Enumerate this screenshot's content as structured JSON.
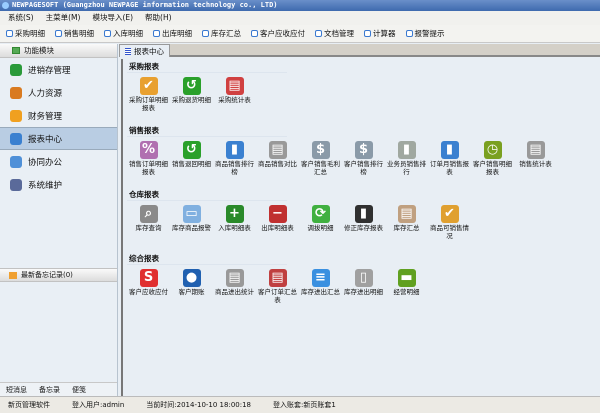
{
  "title": "NEWPAGESOFT (Guangzhou NEWPAGE information technology co., LTD)",
  "menu": [
    "系统(S)",
    "主菜单(M)",
    "模块导入(E)",
    "帮助(H)"
  ],
  "toolbar": [
    "采购明细",
    "销售明细",
    "入库明细",
    "出库明细",
    "库存汇总",
    "客户应收应付",
    "文档管理",
    "计算器",
    "报警提示"
  ],
  "left": {
    "header": "功能模块",
    "nav": [
      {
        "label": "进销存管理",
        "color": "#2a9a3a"
      },
      {
        "label": "人力资源",
        "color": "#d97a20"
      },
      {
        "label": "财务管理",
        "color": "#f0a020"
      },
      {
        "label": "报表中心",
        "color": "#3a80d0"
      },
      {
        "label": "协同办公",
        "color": "#4f90d8"
      },
      {
        "label": "系统维护",
        "color": "#5a6a9a"
      }
    ],
    "selected": "报表中心",
    "memo": "最新备忘记录(0)",
    "bottom_tabs": [
      "短消息",
      "备忘录",
      "便笺"
    ]
  },
  "tab": "报表中心",
  "sections": [
    {
      "title": "采购报表",
      "items": [
        {
          "label": "采购订单明细报表",
          "color": "#e8a030",
          "glyph": "✔"
        },
        {
          "label": "采购退货明细",
          "color": "#2aa02a",
          "glyph": "↺"
        },
        {
          "label": "采购统计表",
          "color": "#d04040",
          "glyph": "▤"
        }
      ]
    },
    {
      "title": "销售报表",
      "items": [
        {
          "label": "销售订单明细报表",
          "color": "#b070b0",
          "glyph": "%"
        },
        {
          "label": "销售退回明细",
          "color": "#2aa02a",
          "glyph": "↺"
        },
        {
          "label": "商品销售排行榜",
          "color": "#3a80d0",
          "glyph": "▮"
        },
        {
          "label": "商品销售对比",
          "color": "#999999",
          "glyph": "▤"
        },
        {
          "label": "客户销售毛利汇总",
          "color": "#8a9aa8",
          "glyph": "$"
        },
        {
          "label": "客户销售排行榜",
          "color": "#8a9aa8",
          "glyph": "$"
        },
        {
          "label": "业务员销售排行",
          "color": "#a0a8a0",
          "glyph": "▮"
        },
        {
          "label": "订单月销售报表",
          "color": "#3a80d0",
          "glyph": "▮"
        },
        {
          "label": "客户销售明细报表",
          "color": "#7aa020",
          "glyph": "◷"
        },
        {
          "label": "销售统计表",
          "color": "#999999",
          "glyph": "▤"
        }
      ]
    },
    {
      "title": "仓库报表",
      "items": [
        {
          "label": "库存查询",
          "color": "#8a8a8a",
          "glyph": "⌕"
        },
        {
          "label": "库存商品报警",
          "color": "#80b0e0",
          "glyph": "▭"
        },
        {
          "label": "入库明细表",
          "color": "#2a8a2a",
          "glyph": "+"
        },
        {
          "label": "出库明细表",
          "color": "#c03030",
          "glyph": "−"
        },
        {
          "label": "调拔明细",
          "color": "#40b040",
          "glyph": "⟳"
        },
        {
          "label": "修正库存报表",
          "color": "#303030",
          "glyph": "▮"
        },
        {
          "label": "库存汇总",
          "color": "#c0a080",
          "glyph": "▤"
        },
        {
          "label": "商品可销售情况",
          "color": "#e0a030",
          "glyph": "✔"
        }
      ]
    },
    {
      "title": "综合报表",
      "items": [
        {
          "label": "客户应收应付",
          "color": "#e03030",
          "glyph": "S"
        },
        {
          "label": "客户期账",
          "color": "#2060b0",
          "glyph": "●"
        },
        {
          "label": "商品进出统计",
          "color": "#999999",
          "glyph": "▤"
        },
        {
          "label": "客户订单汇总表",
          "color": "#c04040",
          "glyph": "▤"
        },
        {
          "label": "库存进出汇总",
          "color": "#3a90e0",
          "glyph": "≡"
        },
        {
          "label": "库存进出明细",
          "color": "#a0a0a0",
          "glyph": "▯"
        },
        {
          "label": "经营明细",
          "color": "#60a020",
          "glyph": "▬"
        }
      ]
    }
  ],
  "status": [
    "新页管理软件",
    "登入用户:admin",
    "当前时间:2014-10-10 18:00:18",
    "登入账套:新页账套1"
  ]
}
